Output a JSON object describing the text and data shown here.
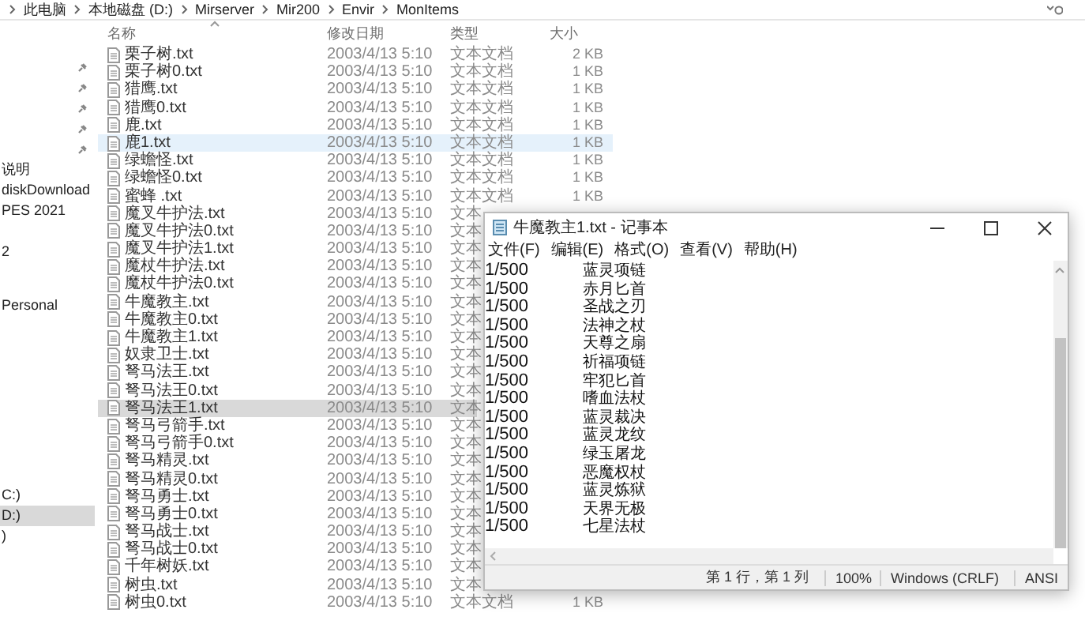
{
  "breadcrumb": [
    "此电脑",
    "本地磁盘 (D:)",
    "Mirserver",
    "Mir200",
    "Envir",
    "MonItems"
  ],
  "sidebar": {
    "groups": [
      {
        "items": [
          {
            "label": "说明",
            "selected": false
          },
          {
            "label": "diskDownload",
            "selected": false
          },
          {
            "label": "PES 2021",
            "selected": false
          }
        ]
      },
      {
        "items": [
          {
            "label": "2",
            "selected": false
          }
        ]
      },
      {
        "items": [
          {
            "label": "Personal",
            "selected": false
          }
        ]
      },
      {
        "items": [
          {
            "label": "C:)",
            "selected": false
          },
          {
            "label": "D:)",
            "selected": true
          },
          {
            "label": ")",
            "selected": false
          }
        ]
      }
    ]
  },
  "table": {
    "columns": [
      "名称",
      "修改日期",
      "类型",
      "大小"
    ],
    "rows": [
      {
        "name": "栗子树.txt",
        "date": "2003/4/13 5:10",
        "type": "文本文档",
        "size": "2 KB",
        "selected": false,
        "hovered": false
      },
      {
        "name": "栗子树0.txt",
        "date": "2003/4/13 5:10",
        "type": "文本文档",
        "size": "1 KB",
        "selected": false,
        "hovered": false
      },
      {
        "name": "猎鹰.txt",
        "date": "2003/4/13 5:10",
        "type": "文本文档",
        "size": "1 KB",
        "selected": false,
        "hovered": false
      },
      {
        "name": "猎鹰0.txt",
        "date": "2003/4/13 5:10",
        "type": "文本文档",
        "size": "1 KB",
        "selected": false,
        "hovered": false
      },
      {
        "name": "鹿.txt",
        "date": "2003/4/13 5:10",
        "type": "文本文档",
        "size": "1 KB",
        "selected": false,
        "hovered": false
      },
      {
        "name": "鹿1.txt",
        "date": "2003/4/13 5:10",
        "type": "文本文档",
        "size": "1 KB",
        "selected": false,
        "hovered": true
      },
      {
        "name": "绿蟾怪.txt",
        "date": "2003/4/13 5:10",
        "type": "文本文档",
        "size": "1 KB",
        "selected": false,
        "hovered": false
      },
      {
        "name": "绿蟾怪0.txt",
        "date": "2003/4/13 5:10",
        "type": "文本文档",
        "size": "1 KB",
        "selected": false,
        "hovered": false
      },
      {
        "name": "蜜蜂 .txt",
        "date": "2003/4/13 5:10",
        "type": "文本文档",
        "size": "1 KB",
        "selected": false,
        "hovered": false
      },
      {
        "name": "魔叉牛护法.txt",
        "date": "2003/4/13 5:10",
        "type": "文本",
        "selected": false,
        "hovered": false
      },
      {
        "name": "魔叉牛护法0.txt",
        "date": "2003/4/13 5:10",
        "type": "文本",
        "selected": false,
        "hovered": false
      },
      {
        "name": "魔叉牛护法1.txt",
        "date": "2003/4/13 5:10",
        "type": "文本",
        "selected": false,
        "hovered": false
      },
      {
        "name": "魔杖牛护法.txt",
        "date": "2003/4/13 5:10",
        "type": "文本",
        "selected": false,
        "hovered": false
      },
      {
        "name": "魔杖牛护法0.txt",
        "date": "2003/4/13 5:10",
        "type": "文本",
        "selected": false,
        "hovered": false
      },
      {
        "name": "牛魔教主.txt",
        "date": "2003/4/13 5:10",
        "type": "文本",
        "selected": false,
        "hovered": false
      },
      {
        "name": "牛魔教主0.txt",
        "date": "2003/4/13 5:10",
        "type": "文本",
        "selected": false,
        "hovered": false
      },
      {
        "name": "牛魔教主1.txt",
        "date": "2003/4/13 5:10",
        "type": "文本",
        "selected": false,
        "hovered": false
      },
      {
        "name": "奴隶卫士.txt",
        "date": "2003/4/13 5:10",
        "type": "文本",
        "selected": false,
        "hovered": false
      },
      {
        "name": "弩马法王.txt",
        "date": "2003/4/13 5:10",
        "type": "文本",
        "selected": false,
        "hovered": false
      },
      {
        "name": "弩马法王0.txt",
        "date": "2003/4/13 5:10",
        "type": "文本",
        "selected": false,
        "hovered": false
      },
      {
        "name": "弩马法王1.txt",
        "date": "2003/4/13 5:10",
        "type": "文本",
        "selected": true,
        "hovered": false
      },
      {
        "name": "弩马弓箭手.txt",
        "date": "2003/4/13 5:10",
        "type": "文本",
        "selected": false,
        "hovered": false
      },
      {
        "name": "弩马弓箭手0.txt",
        "date": "2003/4/13 5:10",
        "type": "文本",
        "selected": false,
        "hovered": false
      },
      {
        "name": "弩马精灵.txt",
        "date": "2003/4/13 5:10",
        "type": "文本",
        "selected": false,
        "hovered": false
      },
      {
        "name": "弩马精灵0.txt",
        "date": "2003/4/13 5:10",
        "type": "文本",
        "selected": false,
        "hovered": false
      },
      {
        "name": "弩马勇士.txt",
        "date": "2003/4/13 5:10",
        "type": "文本",
        "selected": false,
        "hovered": false
      },
      {
        "name": "弩马勇士0.txt",
        "date": "2003/4/13 5:10",
        "type": "文本",
        "selected": false,
        "hovered": false
      },
      {
        "name": "弩马战士.txt",
        "date": "2003/4/13 5:10",
        "type": "文本",
        "selected": false,
        "hovered": false
      },
      {
        "name": "弩马战士0.txt",
        "date": "2003/4/13 5:10",
        "type": "文本",
        "selected": false,
        "hovered": false
      },
      {
        "name": "千年树妖.txt",
        "date": "2003/4/13 5:10",
        "type": "文本",
        "selected": false,
        "hovered": false
      },
      {
        "name": "树虫.txt",
        "date": "2003/4/13 5:10",
        "type": "文本",
        "selected": false,
        "hovered": false
      },
      {
        "name": "树虫0.txt",
        "date": "2003/4/13 5:10",
        "type": "文本文档",
        "size": "1 KB",
        "selected": false,
        "hovered": false
      }
    ]
  },
  "notepad": {
    "title": "牛魔教主1.txt - 记事本",
    "menu": [
      "文件(F)",
      "编辑(E)",
      "格式(O)",
      "查看(V)",
      "帮助(H)"
    ],
    "lines": [
      {
        "rate": "1/500",
        "item": "蓝灵项链"
      },
      {
        "rate": "1/500",
        "item": "赤月匕首"
      },
      {
        "rate": "1/500",
        "item": "圣战之刃"
      },
      {
        "rate": "1/500",
        "item": "法神之杖"
      },
      {
        "rate": "1/500",
        "item": "天尊之扇"
      },
      {
        "rate": "1/500",
        "item": "祈福项链"
      },
      {
        "rate": "1/500",
        "item": "牢犯匕首"
      },
      {
        "rate": "1/500",
        "item": "嗜血法杖"
      },
      {
        "rate": "1/500",
        "item": "蓝灵裁决"
      },
      {
        "rate": "1/500",
        "item": "蓝灵龙纹"
      },
      {
        "rate": "1/500",
        "item": "绿玉屠龙"
      },
      {
        "rate": "1/500",
        "item": "恶魔权杖"
      },
      {
        "rate": "1/500",
        "item": "蓝灵炼狱"
      },
      {
        "rate": "1/500",
        "item": "天界无极"
      },
      {
        "rate": "1/500",
        "item": "七星法杖"
      }
    ],
    "status": {
      "position": "第 1 行，第 1 列",
      "zoom": "100%",
      "line_ending": "Windows (CRLF)",
      "encoding": "ANSI"
    }
  }
}
